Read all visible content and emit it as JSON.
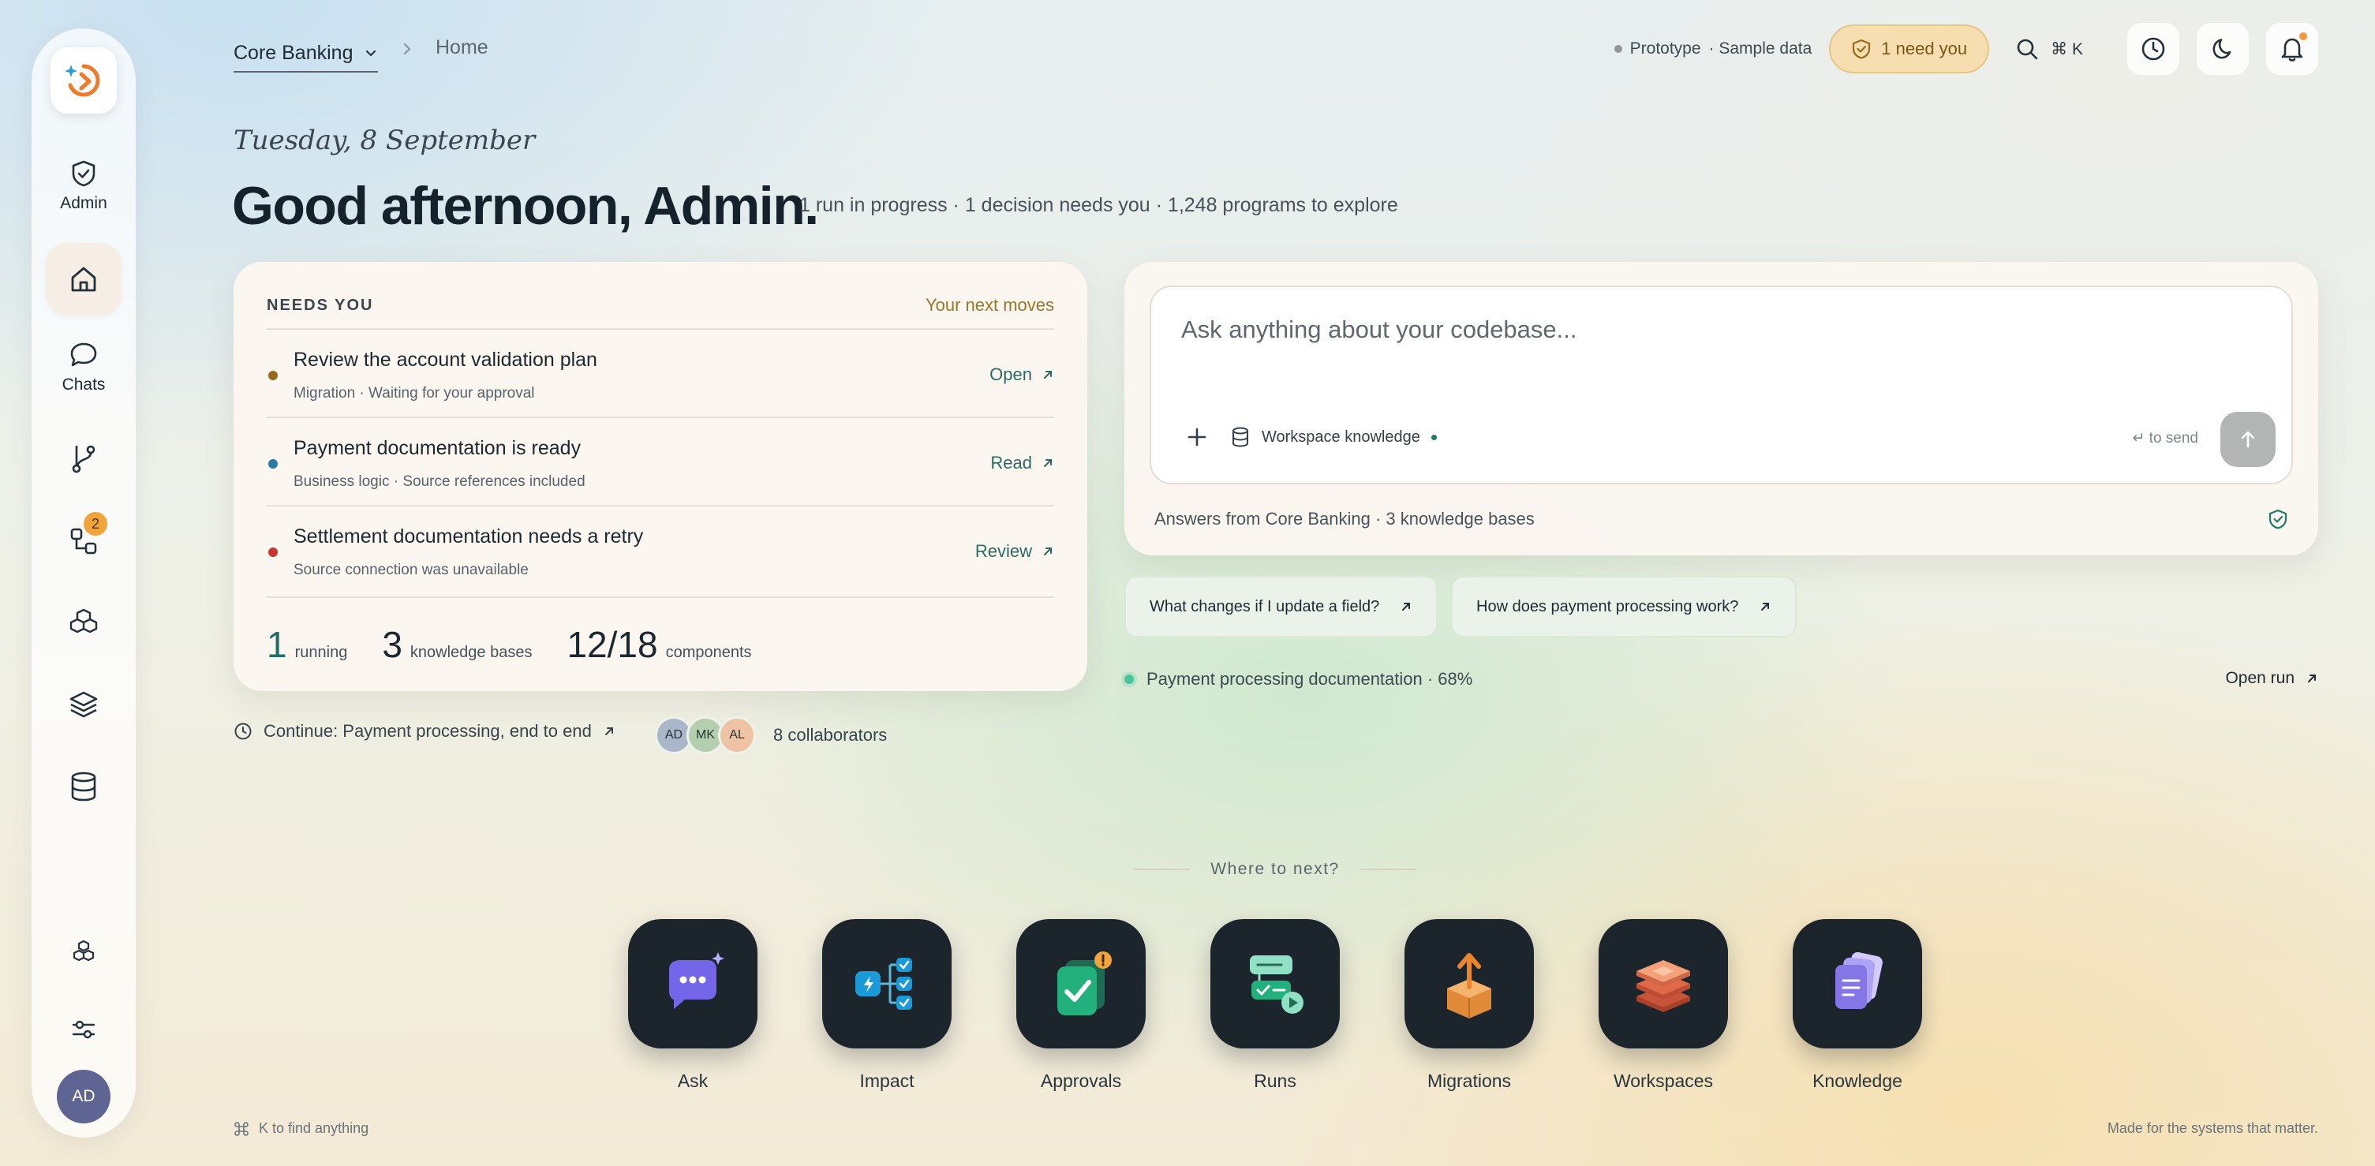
{
  "sidebar": {
    "admin_label": "Admin",
    "chats_label": "Chats",
    "approvals_badge": "2",
    "avatar_initials": "AD"
  },
  "header": {
    "workspace": "Core Banking",
    "breadcrumb_home": "Home",
    "prototype_label": "Prototype",
    "sample_data_label": "· Sample data",
    "need_you_label": "1 need you",
    "search_shortcut": "⌘ K"
  },
  "greeting": {
    "date": "Tuesday, 8 September",
    "title": "Good afternoon, Admin.",
    "summary": "1 run in progress · 1 decision needs you · 1,248 programs to explore"
  },
  "needs_you": {
    "title": "NEEDS YOU",
    "subtitle": "Your next moves",
    "tasks": [
      {
        "title": "Review the account validation plan",
        "meta": "Migration · Waiting for your approval",
        "action": "Open",
        "color": "#9a6a1c"
      },
      {
        "title": "Payment documentation is ready",
        "meta": "Business logic · Source references included",
        "action": "Read",
        "color": "#2a7aa6"
      },
      {
        "title": "Settlement documentation needs a retry",
        "meta": "Source connection was unavailable",
        "action": "Review",
        "color": "#c8372d"
      }
    ],
    "stats": [
      {
        "num": "1",
        "label": "running"
      },
      {
        "num": "3",
        "label": "knowledge bases"
      },
      {
        "num": "12/18",
        "label": "components"
      }
    ]
  },
  "continue_label": "Continue: Payment processing, end to end",
  "collaborators": {
    "avatars": [
      {
        "initials": "AD",
        "color": "#a9b7c8"
      },
      {
        "initials": "MK",
        "color": "#b4cfae"
      },
      {
        "initials": "AL",
        "color": "#eec4a4"
      }
    ],
    "label": "8 collaborators"
  },
  "ask": {
    "placeholder": "Ask anything about your codebase...",
    "knowledge_chip": "Workspace knowledge",
    "send_hint": "↵ to send",
    "footer": "Answers from Core Banking · 3 knowledge bases"
  },
  "suggestions": [
    "What changes if I update a field?",
    "How does payment processing work?"
  ],
  "progress": {
    "label": "Payment processing documentation · 68%",
    "value": 0.68,
    "action": "Open run"
  },
  "where_next": {
    "title": "Where to next?",
    "apps": [
      {
        "label": "Ask",
        "icon": "chat-sparkle-icon"
      },
      {
        "label": "Impact",
        "icon": "impact-flow-icon"
      },
      {
        "label": "Approvals",
        "icon": "approval-check-icon"
      },
      {
        "label": "Runs",
        "icon": "runs-play-icon"
      },
      {
        "label": "Migrations",
        "icon": "migration-box-icon"
      },
      {
        "label": "Workspaces",
        "icon": "workspace-layers-icon"
      },
      {
        "label": "Knowledge",
        "icon": "knowledge-docs-icon"
      }
    ]
  },
  "footer": {
    "shortcut_hint": "K to find anything",
    "tagline": "Made for the systems that matter."
  },
  "colors": {
    "accent_teal": "#1f6d66",
    "warning_amber": "#f6deb0",
    "brand_orange": "#f07a2a"
  }
}
